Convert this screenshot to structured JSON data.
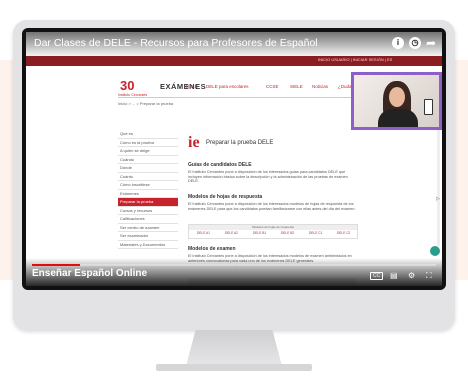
{
  "video": {
    "title": "Dar Clases de DELE - Recursos para Profesores de Español",
    "channel_overlay": "Enseñar Español Online",
    "progress": 0.12,
    "icons": [
      "info-icon",
      "clock-icon",
      "share-icon"
    ]
  },
  "site": {
    "topbar_text": "INICIO USUARIO | INICIAR SESIÓN | ES",
    "logo_mark": "30",
    "logo_sub": "Instituto Cervantes",
    "brand": "EXÁMENES",
    "nav": [
      "DELE",
      "DELE para escolares",
      "CCSE",
      "SIELE",
      "Noticias",
      "¿Dudas?"
    ],
    "breadcrumb": "Inicio > ... > Preparar la prueba",
    "sidebar": [
      "Qué es",
      "Cómo es la prueba",
      "A quién se dirige",
      "Cuándo",
      "Dónde",
      "Cuánto",
      "Cómo inscribirse",
      "Exámenes",
      "Preparar la prueba",
      "Cursos y recursos",
      "Calificaciones",
      "Ser centro de examen",
      "Ser examinador",
      "Materiales y Documentos"
    ],
    "active_sidebar_index": 8,
    "ie_mark": "ie",
    "page_heading": "Preparar la prueba DELE",
    "section1_title": "Guías de candidatos DELE",
    "section1_text": "El Instituto Cervantes pone a disposición de los interesados guías para candidatos DELE que incluyen información básica sobre la descripción y la administración de las pruebas de examen DELE.",
    "section2_title": "Modelos de hojas de respuesta",
    "section2_text": "El Instituto Cervantes pone a disposición de los interesados modelos de hojas de respuesta de los exámenes DELE para que los candidatos puedan familiarizarse con ellas antes del día del examen.",
    "table_header": "Modelos de hojas de respuesta",
    "table_cells": [
      "DELE A1",
      "DELE A2",
      "DELE B1",
      "DELE B2",
      "DELE C1",
      "DELE C2"
    ],
    "section3_title": "Modelos de examen",
    "section3_text": "El Instituto Cervantes pone a disposición de los interesados modelos de examen ambientados en anteriores convocatorias para cada uno de los exámenes DELE generales."
  },
  "colors": {
    "brand_red": "#c8232c",
    "cam_border": "#8d5fc7",
    "progress_red": "#e10d0d"
  }
}
